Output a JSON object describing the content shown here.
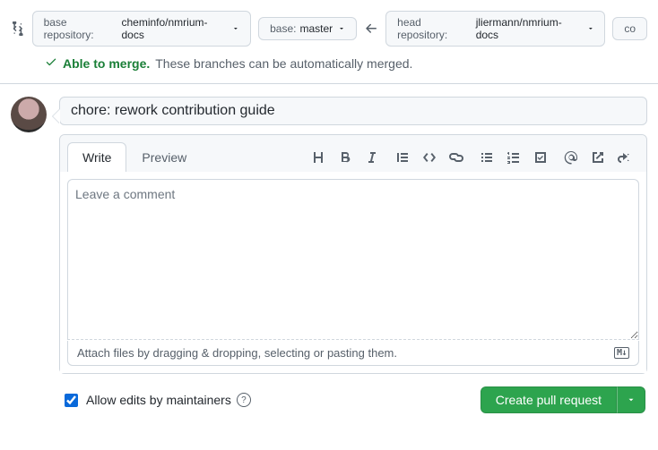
{
  "compare": {
    "base_repo_label": "base repository:",
    "base_repo_value": "cheminfo/nmrium-docs",
    "base_branch_label": "base:",
    "base_branch_value": "master",
    "head_repo_label": "head repository:",
    "head_repo_value": "jliermann/nmrium-docs",
    "head_branch_cut": "co"
  },
  "merge": {
    "able": "Able to merge.",
    "auto": "These branches can be automatically merged."
  },
  "pr": {
    "title": "chore: rework contribution guide",
    "tabs": {
      "write": "Write",
      "preview": "Preview"
    },
    "placeholder": "Leave a comment",
    "attach_hint": "Attach files by dragging & dropping, selecting or pasting them.",
    "md_badge": "M↓"
  },
  "footer": {
    "allow_edits": "Allow edits by maintainers",
    "create_btn": "Create pull request"
  }
}
